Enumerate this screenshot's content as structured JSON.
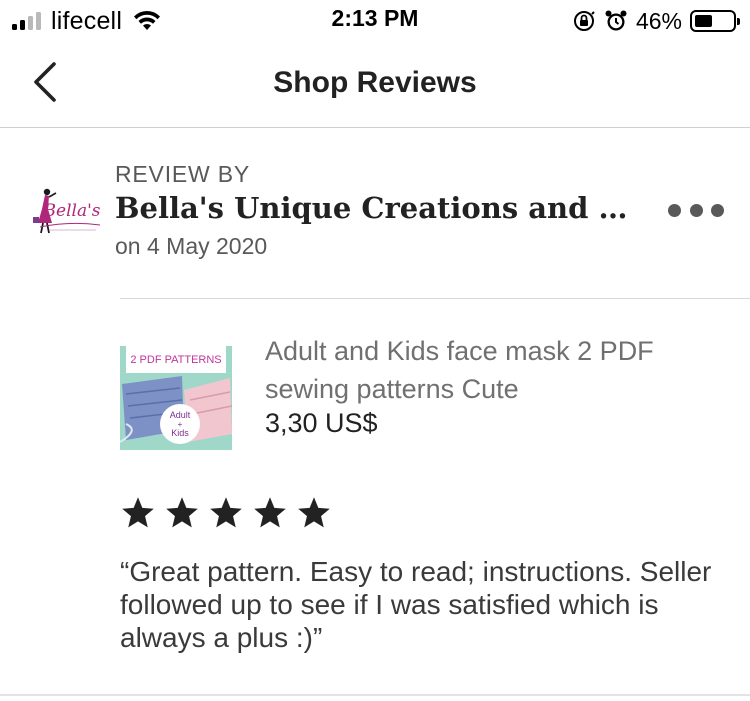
{
  "status_bar": {
    "carrier": "lifecell",
    "time": "2:13 PM",
    "battery_percent": "46%",
    "battery_level": 0.46,
    "signal_bars_active": 2,
    "signal_bars_total": 4
  },
  "nav": {
    "title": "Shop Reviews",
    "back_icon": "chevron-left-icon"
  },
  "review": {
    "review_by_label": "REVIEW BY",
    "reviewer_name": "Bella's Unique Creations and Desig...",
    "date": "on 4 May 2020",
    "more_icon": "more-horizontal-icon",
    "avatar_logo_text": "Bella's",
    "product": {
      "title": "Adult and Kids face mask 2 PDF sewing patterns Cute",
      "price": "3,30 US$",
      "thumbnail_banner": "2 PDF PATTERNS",
      "thumbnail_badge_top": "Adult",
      "thumbnail_badge_plus": "+",
      "thumbnail_badge_bottom": "Kids"
    },
    "rating": 5,
    "rating_max": 5,
    "text": "“Great pattern. Easy to read; instructions. Seller followed up to see if I was satisfied which is always a plus :)”"
  },
  "colors": {
    "text_primary": "#222222",
    "text_secondary": "#595959",
    "star": "#222222",
    "divider": "#d9d9d9",
    "logo_pink": "#b0267a"
  }
}
